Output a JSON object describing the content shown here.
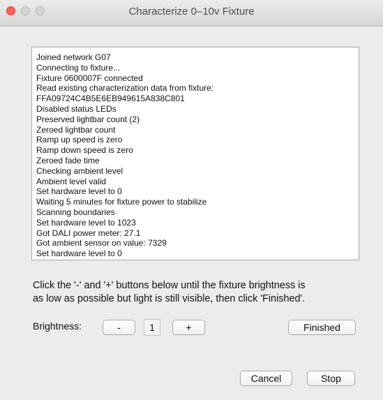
{
  "window": {
    "title": "Characterize 0–10v Fixture"
  },
  "log": {
    "lines": [
      "Joined network G07",
      "Connecting to fixture...",
      "Fixture 0600007F connected",
      "Read existing characterization data from fixture:",
      "FFA09724C4B5E6EB949615A838C801",
      "Disabled status LEDs",
      "Preserved lightbar count (2)",
      "Zeroed lightbar count",
      "Ramp up speed is zero",
      "Ramp down speed is zero",
      "Zeroed fade time",
      "Checking ambient level",
      "Ambient level valid",
      "Set hardware level to 0",
      "Waiting 5 minutes for fixture power to stabilize",
      "Scanning boundaries",
      "Set hardware level to 1023",
      "Got DALI power meter: 27.1",
      "Got ambient sensor on value: 7329",
      "Set hardware level to 0"
    ]
  },
  "instructions": {
    "line1": "Click the '-' and '+' buttons below until the fixture brightness is",
    "line2": "as low as possible but light is still visible, then click 'Finished'."
  },
  "brightness": {
    "label": "Brightness:",
    "minus_label": "-",
    "value": "1",
    "plus_label": "+"
  },
  "buttons": {
    "finished": "Finished",
    "cancel": "Cancel",
    "stop": "Stop"
  }
}
